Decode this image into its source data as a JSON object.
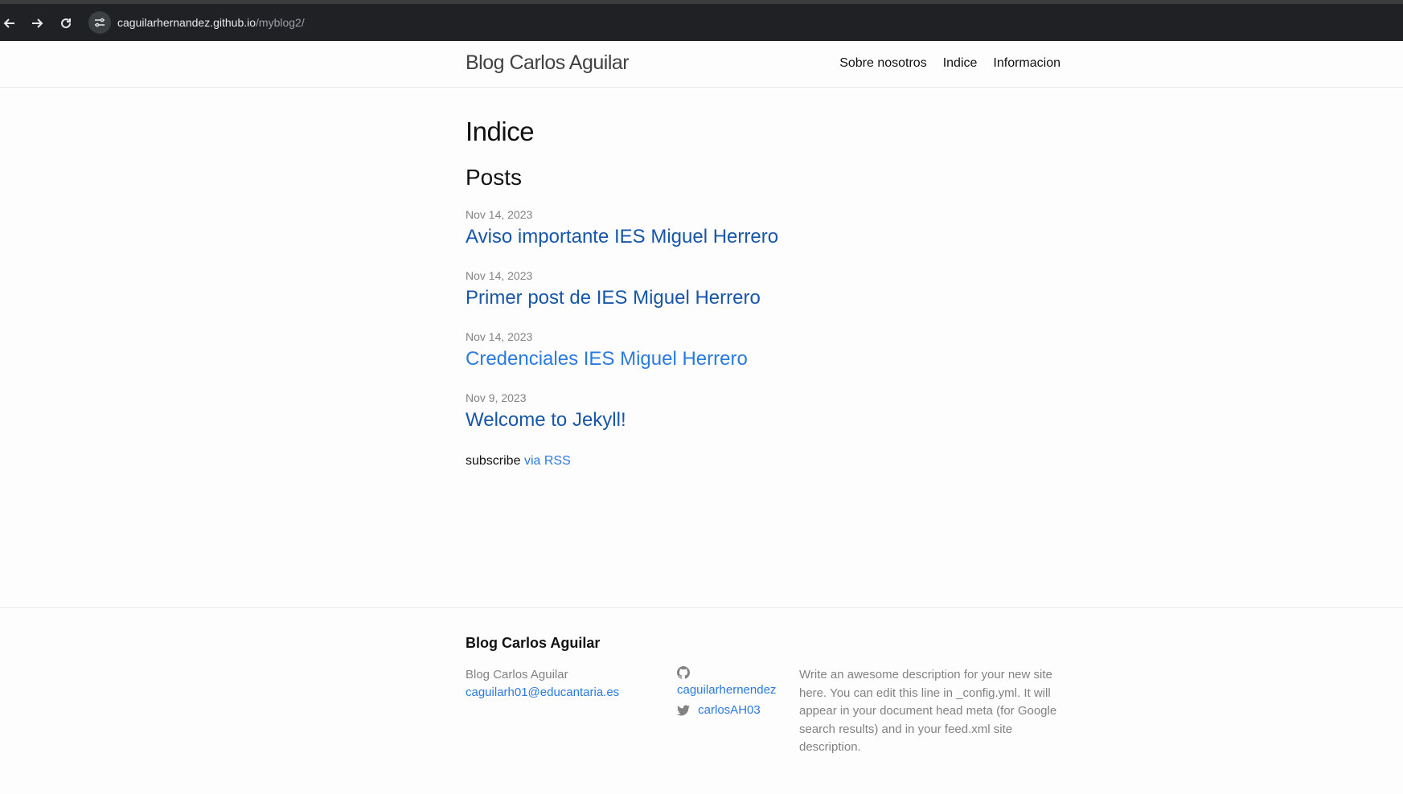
{
  "browser": {
    "url_host": "caguilarhernandez.github.io",
    "url_path": "/myblog2/"
  },
  "header": {
    "site_title": "Blog Carlos Aguilar",
    "nav": [
      "Sobre nosotros",
      "Indice",
      "Informacion"
    ]
  },
  "main": {
    "page_heading": "Indice",
    "posts_heading": "Posts",
    "posts": [
      {
        "date": "Nov 14, 2023",
        "title": "Aviso importante IES Miguel Herrero"
      },
      {
        "date": "Nov 14, 2023",
        "title": "Primer post de IES Miguel Herrero"
      },
      {
        "date": "Nov 14, 2023",
        "title": "Credenciales IES Miguel Herrero"
      },
      {
        "date": "Nov 9, 2023",
        "title": "Welcome to Jekyll!"
      }
    ],
    "subscribe_text": "subscribe",
    "subscribe_link": "via RSS"
  },
  "footer": {
    "heading": "Blog Carlos Aguilar",
    "name": "Blog Carlos Aguilar",
    "email": "caguilarh01@educantaria.es",
    "github_user": "caguilarhernendez",
    "twitter_user": "carlosAH03",
    "description": "Write an awesome description for your new site here. You can edit this line in _config.yml. It will appear in your document head meta (for Google search results) and in your feed.xml site description."
  },
  "colors": {
    "link": "#2a7ae2",
    "link_visited": "#1756a9",
    "meta_grey": "#828282",
    "chrome_bg": "#202124"
  }
}
